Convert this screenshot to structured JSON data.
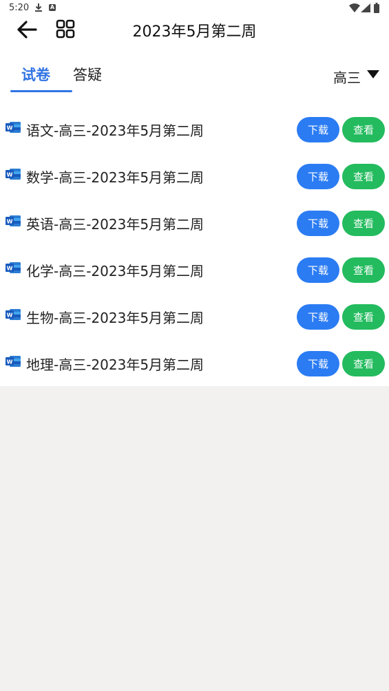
{
  "status_bar": {
    "time": "5:20",
    "notif_letter": "A"
  },
  "header": {
    "title": "2023年5月第二周"
  },
  "tabs": [
    {
      "label": "试卷",
      "active": true
    },
    {
      "label": "答疑",
      "active": false
    }
  ],
  "grade_filter": {
    "value": "高三"
  },
  "documents": [
    {
      "name": "语文-高三-2023年5月第二周",
      "download_label": "下载",
      "view_label": "查看"
    },
    {
      "name": "数学-高三-2023年5月第二周",
      "download_label": "下载",
      "view_label": "查看"
    },
    {
      "name": "英语-高三-2023年5月第二周",
      "download_label": "下载",
      "view_label": "查看"
    },
    {
      "name": "化学-高三-2023年5月第二周",
      "download_label": "下载",
      "view_label": "查看"
    },
    {
      "name": "生物-高三-2023年5月第二周",
      "download_label": "下载",
      "view_label": "查看"
    },
    {
      "name": "地理-高三-2023年5月第二周",
      "download_label": "下载",
      "view_label": "查看"
    }
  ],
  "colors": {
    "accent": "#2f73e3",
    "download_button": "#2b7cf3",
    "view_button": "#23bb5e",
    "background": "#f2f1f0"
  }
}
